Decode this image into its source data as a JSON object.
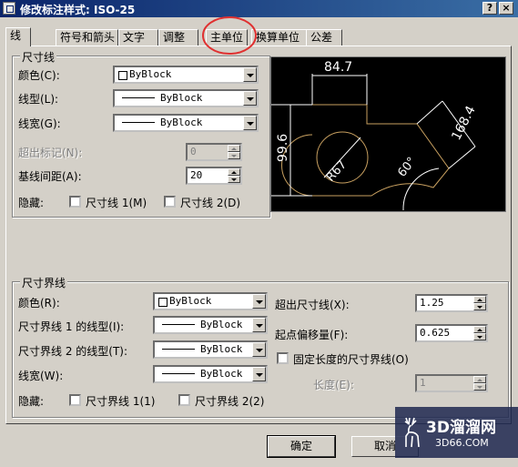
{
  "window": {
    "title": "修改标注样式: ISO-25",
    "help_btn": "?",
    "close_btn": "×"
  },
  "tabs": [
    "线",
    "符号和箭头",
    "文字",
    "调整",
    "主单位",
    "换算单位",
    "公差"
  ],
  "active_tab": 0,
  "dim_lines": {
    "legend": "尺寸线",
    "color_label": "颜色(C):",
    "color_value": "ByBlock",
    "linetype_label": "线型(L):",
    "linetype_value": "ByBlock",
    "lineweight_label": "线宽(G):",
    "lineweight_value": "ByBlock",
    "extend_label": "超出标记(N):",
    "extend_value": "0",
    "baseline_label": "基线间距(A):",
    "baseline_value": "20",
    "suppress_label": "隐藏:",
    "suppress_1": "尺寸线 1(M)",
    "suppress_2": "尺寸线 2(D)"
  },
  "ext_lines": {
    "legend": "尺寸界线",
    "color_label": "颜色(R):",
    "color_value": "ByBlock",
    "lt1_label": "尺寸界线 1 的线型(I):",
    "lt1_value": "ByBlock",
    "lt2_label": "尺寸界线 2 的线型(T):",
    "lt2_value": "ByBlock",
    "lw_label": "线宽(W):",
    "lw_value": "ByBlock",
    "suppress_label": "隐藏:",
    "suppress_1": "尺寸界线 1(1)",
    "suppress_2": "尺寸界线 2(2)",
    "beyond_label": "超出尺寸线(X):",
    "beyond_value": "1.25",
    "offset_label": "起点偏移量(F):",
    "offset_value": "0.625",
    "fixed_label": "固定长度的尺寸界线(O)",
    "length_label": "长度(E):",
    "length_value": "1"
  },
  "preview": {
    "dim_top": "84.7",
    "dim_left": "99.6",
    "dim_right": "168.4",
    "dim_radius": "R67",
    "dim_angle": "60°"
  },
  "buttons": {
    "ok": "确定",
    "cancel": "取消"
  },
  "watermark": {
    "brand": "3D溜溜网",
    "url": "3D66.COM"
  },
  "colors": {
    "title_bar": "#0a246a",
    "preview_bg": "#000000",
    "preview_lines": "#ffffff",
    "preview_geometry": "#c8a060",
    "annotation_circle": "#e03030"
  }
}
